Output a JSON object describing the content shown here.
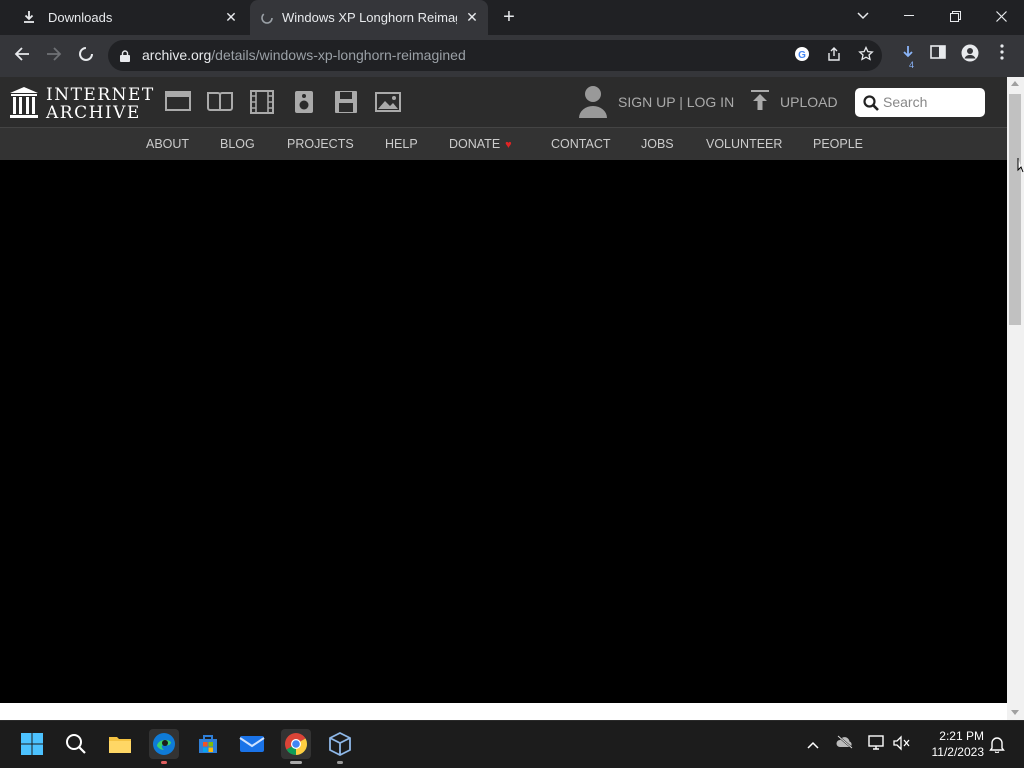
{
  "browser": {
    "tabs": [
      {
        "title": "Downloads",
        "icon": "download-icon",
        "active": false
      },
      {
        "title": "Windows XP Longhorn Reimagin",
        "icon": "loading-icon",
        "active": true
      }
    ],
    "url_host": "archive.org",
    "url_path": "/details/windows-xp-longhorn-reimagined",
    "download_count": "4"
  },
  "ia": {
    "logo_line1": "INTERNET",
    "logo_line2": "ARCHIVE",
    "signup_login": "SIGN UP | LOG IN",
    "upload_label": "UPLOAD",
    "search_placeholder": "Search",
    "nav": [
      "ABOUT",
      "BLOG",
      "PROJECTS",
      "HELP",
      "DONATE",
      "CONTACT",
      "JOBS",
      "VOLUNTEER",
      "PEOPLE"
    ],
    "media_icons": [
      "web-icon",
      "texts-icon",
      "video-icon",
      "audio-icon",
      "software-icon",
      "images-icon"
    ]
  },
  "taskbar": {
    "apps": [
      "start-icon",
      "search-icon",
      "file-explorer-icon",
      "edge-icon",
      "store-icon",
      "mail-icon",
      "chrome-icon",
      "virtualbox-icon"
    ],
    "time": "2:21 PM",
    "date": "11/2/2023"
  },
  "colors": {
    "chrome_dark": "#202124",
    "chrome_toolbar": "#35363a",
    "ia_header": "#2c2c2c",
    "ia_nav": "#333333",
    "donate_heart": "#e02424",
    "taskbar": "#1c1c1c"
  }
}
